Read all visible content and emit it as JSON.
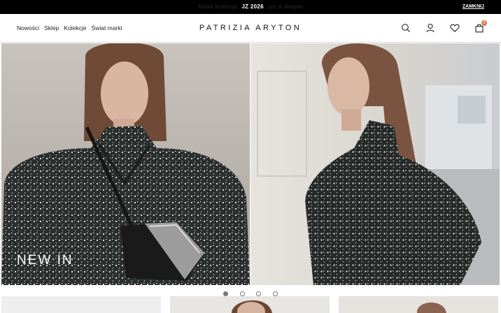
{
  "announcement": {
    "prefix": "Nowa kolekcja",
    "highlight": "JZ 2026",
    "suffix": "już w sklepie",
    "close_label": "ZAMKNIJ"
  },
  "header": {
    "nav": [
      "Nowości",
      "Sklep",
      "Kolekcje",
      "Świat marki"
    ],
    "logo": "PATRIZIA ARYTON",
    "cart_count": "0",
    "icons": [
      "search-icon",
      "account-icon",
      "wishlist-icon",
      "bag-icon"
    ]
  },
  "hero": {
    "caption": "NEW IN",
    "slides_total": 4,
    "active_slide": 1
  },
  "colors": {
    "topbar_bg": "#000000",
    "badge": "#d97a4a",
    "coat": "#2b302f"
  }
}
